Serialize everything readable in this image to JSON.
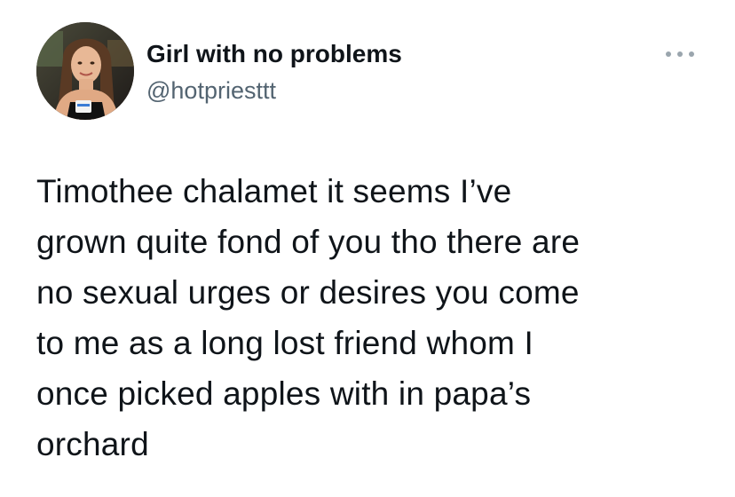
{
  "tweet": {
    "author": {
      "display_name": "Girl with no problems",
      "handle": "@hotpriesttt",
      "avatar_icon": "profile-photo"
    },
    "more_icon": "more-horizontal-icon",
    "text": "Timothee chalamet it seems I’ve\ngrown quite fond of you tho there are\nno sexual urges or desires you come\nto me as a long lost friend whom I\nonce picked apples with in papa’s\norchard"
  },
  "colors": {
    "text": "#0f1419",
    "secondary_text": "#536471",
    "background": "#ffffff"
  }
}
